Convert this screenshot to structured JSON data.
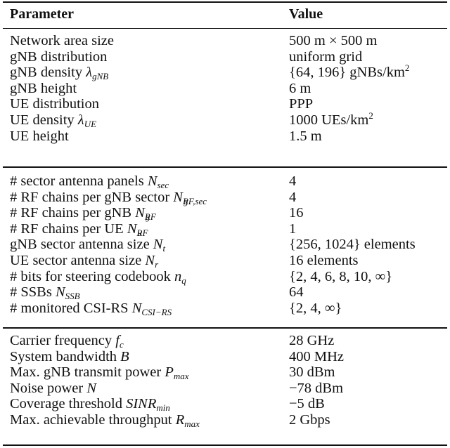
{
  "table": {
    "headers": {
      "parameter": "Parameter",
      "value": "Value"
    },
    "sections": [
      {
        "rows": [
          {
            "label": "Network area size",
            "sym": "",
            "sub": "",
            "sup": "",
            "value": "500 m × 500 m",
            "value_sup": ""
          },
          {
            "label": "gNB distribution",
            "sym": "",
            "sub": "",
            "sup": "",
            "value": "uniform grid",
            "value_sup": ""
          },
          {
            "label": "gNB density ",
            "sym": "λ",
            "sub": "gNB",
            "sup": "",
            "value": "{64, 196} gNBs/km",
            "value_sup": "2"
          },
          {
            "label": "gNB height",
            "sym": "",
            "sub": "",
            "sup": "",
            "value": "6 m",
            "value_sup": ""
          },
          {
            "label": "UE distribution",
            "sym": "",
            "sub": "",
            "sup": "",
            "value": "PPP",
            "value_sup": ""
          },
          {
            "label": "UE density ",
            "sym": "λ",
            "sub": "UE",
            "sup": "",
            "value": "1000 UEs/km",
            "value_sup": "2"
          },
          {
            "label": "UE height",
            "sym": "",
            "sub": "",
            "sup": "",
            "value": "1.5 m",
            "value_sup": ""
          }
        ]
      },
      {
        "rows": [
          {
            "label": "# sector antenna panels ",
            "sym": "N",
            "sub": "sec",
            "sup": "",
            "value": "4",
            "value_sup": ""
          },
          {
            "label": "# RF chains per gNB sector ",
            "sym": "N",
            "sub": "RF,sec",
            "sup": "g",
            "value": "4",
            "value_sup": ""
          },
          {
            "label": "# RF chains per gNB ",
            "sym": "N",
            "sub": "RF",
            "sup": "g",
            "value": "16",
            "value_sup": ""
          },
          {
            "label": "# RF chains per UE ",
            "sym": "N",
            "sub": "RF",
            "sup": "u",
            "value": "1",
            "value_sup": ""
          },
          {
            "label": "gNB sector antenna size ",
            "sym": "N",
            "sub": "t",
            "sup": "",
            "value": "{256, 1024} elements",
            "value_sup": ""
          },
          {
            "label": "UE sector antenna size ",
            "sym": "N",
            "sub": "r",
            "sup": "",
            "value": "16 elements",
            "value_sup": ""
          },
          {
            "label": "# bits for steering codebook ",
            "sym": "n",
            "sub": "q",
            "sup": "",
            "value": "{2, 4, 6, 8, 10, ∞}",
            "value_sup": ""
          },
          {
            "label": "# SSBs ",
            "sym": "N",
            "sub": "SSB",
            "sup": "",
            "value": "64",
            "value_sup": ""
          },
          {
            "label": "# monitored CSI-RS ",
            "sym": "N",
            "sub": "CSI−RS",
            "sup": "",
            "value": "{2, 4, ∞}",
            "value_sup": ""
          }
        ]
      },
      {
        "rows": [
          {
            "label": "Carrier frequency ",
            "sym": "f",
            "sub": "c",
            "sup": "",
            "value": "28 GHz",
            "value_sup": ""
          },
          {
            "label": "System bandwidth ",
            "sym": "B",
            "sub": "",
            "sup": "",
            "value": "400 MHz",
            "value_sup": ""
          },
          {
            "label": "Max. gNB transmit power ",
            "sym": "P",
            "sub": "max",
            "sup": "",
            "value": "30 dBm",
            "value_sup": ""
          },
          {
            "label": "Noise power ",
            "sym": "N",
            "sub": "",
            "sup": "",
            "value": "−78 dBm",
            "value_sup": ""
          },
          {
            "label": "Coverage threshold ",
            "sym": "SINR",
            "sub": "min",
            "sup": "",
            "value": "−5 dB",
            "value_sup": ""
          },
          {
            "label": "Max. achievable throughput ",
            "sym": "R",
            "sub": "max",
            "sup": "",
            "value": "2 Gbps",
            "value_sup": ""
          }
        ]
      }
    ]
  }
}
